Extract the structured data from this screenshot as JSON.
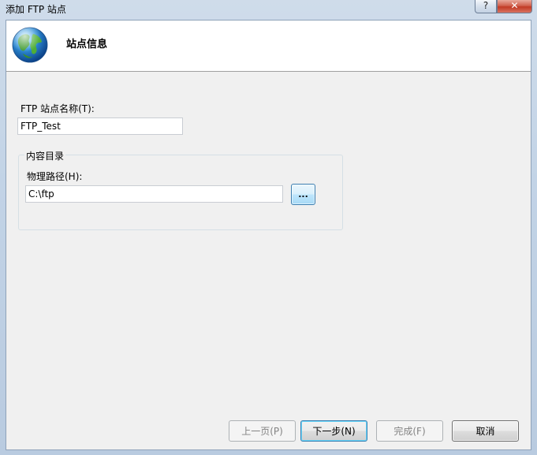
{
  "window": {
    "title": "添加 FTP 站点",
    "help_label": "?",
    "close_label": "✕"
  },
  "header": {
    "title": "站点信息",
    "icon": "globe-icon"
  },
  "form": {
    "site_name_label": "FTP 站点名称(T):",
    "site_name_value": "FTP_Test",
    "content_group_label": "内容目录",
    "physical_path_label": "物理路径(H):",
    "physical_path_value": "C:\\ftp",
    "browse_label": "..."
  },
  "buttons": {
    "prev_label": "上一页(P)",
    "next_label": "下一步(N)",
    "finish_label": "完成(F)",
    "cancel_label": "取消"
  }
}
